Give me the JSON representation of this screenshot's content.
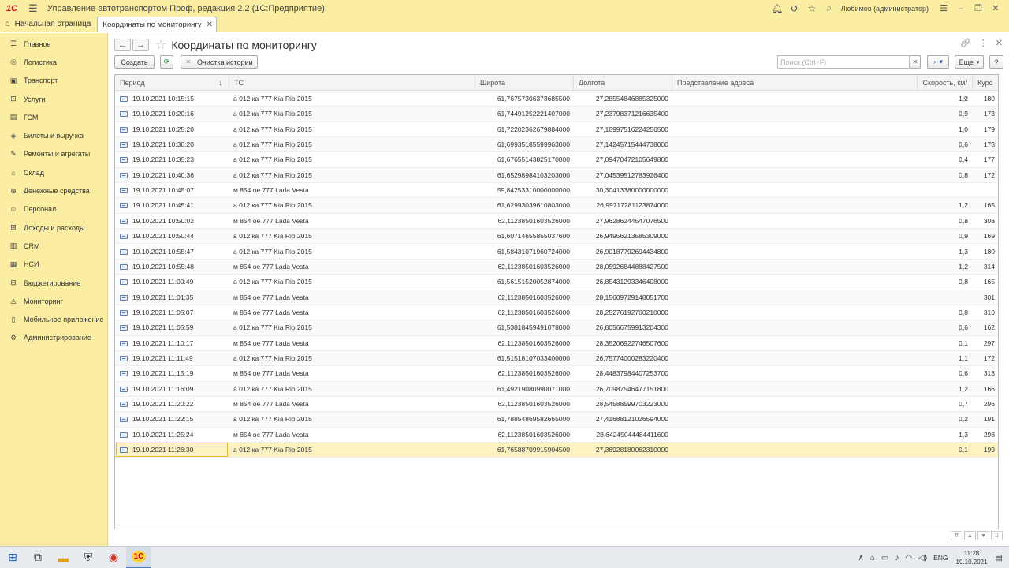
{
  "app": {
    "logo": "1С",
    "title": "Управление автотранспортом Проф, редакция 2.2  (1С:Предприятие)",
    "user": "Любимов (администратор)"
  },
  "tabs": {
    "home": "Начальная страница",
    "active": "Координаты по мониторингу"
  },
  "sidebar": {
    "items": [
      {
        "label": "Главное",
        "icon": "menu-icon"
      },
      {
        "label": "Логистика",
        "icon": "logistics-icon"
      },
      {
        "label": "Транспорт",
        "icon": "truck-icon"
      },
      {
        "label": "Услуги",
        "icon": "services-icon"
      },
      {
        "label": "ГСМ",
        "icon": "fuel-icon"
      },
      {
        "label": "Билеты и выручка",
        "icon": "ticket-icon"
      },
      {
        "label": "Ремонты и агрегаты",
        "icon": "wrench-icon"
      },
      {
        "label": "Склад",
        "icon": "warehouse-icon"
      },
      {
        "label": "Денежные средства",
        "icon": "money-icon"
      },
      {
        "label": "Персонал",
        "icon": "person-icon"
      },
      {
        "label": "Доходы и расходы",
        "icon": "income-icon"
      },
      {
        "label": "CRM",
        "icon": "crm-icon"
      },
      {
        "label": "НСИ",
        "icon": "reference-icon"
      },
      {
        "label": "Бюджетирование",
        "icon": "budget-icon"
      },
      {
        "label": "Мониторинг",
        "icon": "monitoring-icon"
      },
      {
        "label": "Мобильное приложение",
        "icon": "mobile-icon"
      },
      {
        "label": "Администрирование",
        "icon": "gear-icon"
      }
    ]
  },
  "page": {
    "title": "Координаты по мониторингу"
  },
  "toolbar": {
    "create": "Создать",
    "clear_history": "Очистка истории",
    "search_placeholder": "Поиск (Ctrl+F)",
    "more": "Еще",
    "help": "?"
  },
  "table": {
    "headers": {
      "period": "Период",
      "vehicle": "ТС",
      "lat": "Широта",
      "lon": "Долгота",
      "address": "Представление адреса",
      "speed": "Скорость, км/ч",
      "course": "Курс"
    },
    "rows": [
      [
        "19.10.2021 10:15:15",
        "а 012 ка 777 Kia Rio 2015",
        "61,76757306373685500",
        "27,28554846885325000",
        "1,2",
        "180"
      ],
      [
        "19.10.2021 10:20:16",
        "а 012 ка 777 Kia Rio 2015",
        "61,74491252221407000",
        "27,23798371216635400",
        "0,9",
        "173"
      ],
      [
        "19.10.2021 10:25:20",
        "а 012 ка 777 Kia Rio 2015",
        "61,72202362679884000",
        "27,18997516224256500",
        "1,0",
        "179"
      ],
      [
        "19.10.2021 10:30:20",
        "а 012 ка 777 Kia Rio 2015",
        "61,69935185599963000",
        "27,14245715444738000",
        "0,6",
        "173"
      ],
      [
        "19.10.2021 10:35:23",
        "а 012 ка 777 Kia Rio 2015",
        "61,67655143825170000",
        "27,09470472105649800",
        "0,4",
        "177"
      ],
      [
        "19.10.2021 10:40:36",
        "а 012 ка 777 Kia Rio 2015",
        "61,65298984103203000",
        "27,04539512783926400",
        "0,8",
        "172"
      ],
      [
        "19.10.2021 10:45:07",
        "м 854 ое 777 Lada Vesta",
        "59,84253310000000000",
        "30,30413380000000000",
        "",
        ""
      ],
      [
        "19.10.2021 10:45:41",
        "а 012 ка 777 Kia Rio 2015",
        "61,62993039610803000",
        "26,99717281123874000",
        "1,2",
        "165"
      ],
      [
        "19.10.2021 10:50:02",
        "м 854 ое 777 Lada Vesta",
        "62,11238501603526000",
        "27,96286244547076500",
        "0,8",
        "308"
      ],
      [
        "19.10.2021 10:50:44",
        "а 012 ка 777 Kia Rio 2015",
        "61,60714655855037600",
        "26,94956213585309000",
        "0,9",
        "169"
      ],
      [
        "19.10.2021 10:55:47",
        "а 012 ка 777 Kia Rio 2015",
        "61,58431071960724000",
        "26,90187792694434800",
        "1,3",
        "180"
      ],
      [
        "19.10.2021 10:55:48",
        "м 854 ое 777 Lada Vesta",
        "62,11238501603526000",
        "28,05926844888427500",
        "1,2",
        "314"
      ],
      [
        "19.10.2021 11:00:49",
        "а 012 ка 777 Kia Rio 2015",
        "61,56151520052874000",
        "26,85431293346408000",
        "0,8",
        "165"
      ],
      [
        "19.10.2021 11:01:35",
        "м 854 ое 777 Lada Vesta",
        "62,11238501603526000",
        "28,15609729148051700",
        "",
        "301"
      ],
      [
        "19.10.2021 11:05:07",
        "м 854 ое 777 Lada Vesta",
        "62,11238501603526000",
        "28,25276192760210000",
        "0,8",
        "310"
      ],
      [
        "19.10.2021 11:05:59",
        "а 012 ка 777 Kia Rio 2015",
        "61,53818459491078000",
        "26,80566759913204300",
        "0,6",
        "162"
      ],
      [
        "19.10.2021 11:10:17",
        "м 854 ое 777 Lada Vesta",
        "62,11238501603526000",
        "28,35206922746507600",
        "0,1",
        "297"
      ],
      [
        "19.10.2021 11:11:49",
        "а 012 ка 777 Kia Rio 2015",
        "61,51518107033400000",
        "26,75774000283220400",
        "1,1",
        "172"
      ],
      [
        "19.10.2021 11:15:19",
        "м 854 ое 777 Lada Vesta",
        "62,11238501603526000",
        "28,44837984407253700",
        "0,6",
        "313"
      ],
      [
        "19.10.2021 11:16:09",
        "а 012 ка 777 Kia Rio 2015",
        "61,49219080990071000",
        "26,70987546477151800",
        "1,2",
        "166"
      ],
      [
        "19.10.2021 11:20:22",
        "м 854 ое 777 Lada Vesta",
        "62,11238501603526000",
        "28,54588599703223000",
        "0,7",
        "296"
      ],
      [
        "19.10.2021 11:22:15",
        "а 012 ка 777 Kia Rio 2015",
        "61,78854869582665000",
        "27,41688121026594000",
        "0,2",
        "191"
      ],
      [
        "19.10.2021 11:25:24",
        "м 854 ое 777 Lada Vesta",
        "62,11238501603526000",
        "28,64245044484411600",
        "1,3",
        "298"
      ],
      [
        "19.10.2021 11:26:30",
        "а 012 ка 777 Kia Rio 2015",
        "61,76588709915904500",
        "27,36928180062310000",
        "0,1",
        "199"
      ]
    ],
    "selected_index": 23
  },
  "tray": {
    "lang": "ENG",
    "time": "11:28",
    "date": "19.10.2021"
  },
  "colors": {
    "accent_yellow": "#fbeda1",
    "selection": "#fcf2c2",
    "selection_border": "#e4b93b"
  }
}
